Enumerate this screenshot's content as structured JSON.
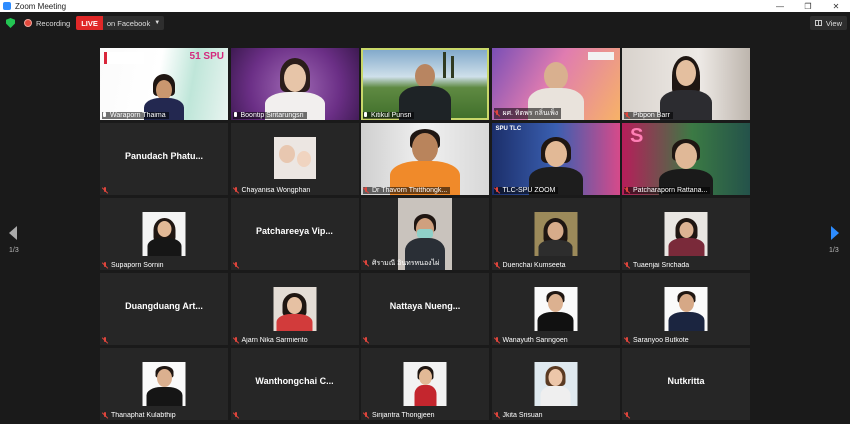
{
  "window": {
    "title": "Zoom Meeting"
  },
  "toolbar": {
    "recording": "Recording",
    "live_badge": "LIVE",
    "live_destination": "on Facebook",
    "view_label": "View"
  },
  "pager": {
    "left_label": "1/3",
    "right_label": "1/3"
  },
  "colors": {
    "accent": "#2d8cff",
    "live_red": "#e02828",
    "mute_red": "#e0453c",
    "active_speaker": "#c9d86a"
  },
  "participants": [
    {
      "name": "Waraporn Thaima",
      "mic": "on"
    },
    {
      "name": "Boontip Siritarungsri",
      "mic": "on"
    },
    {
      "name": "Kitikul Punsri",
      "mic": "on",
      "active": true
    },
    {
      "name": "ผศ. ทิตพร กลิ่นเพ็ง",
      "mic": "off"
    },
    {
      "name": "Pibpon Barr",
      "mic": "off"
    },
    {
      "name": "Panudach Phatu...",
      "mic": "off"
    },
    {
      "name": "Chayanisa Wongphan",
      "mic": "off"
    },
    {
      "name": "Dr Thavorn Thitthongk...",
      "mic": "off"
    },
    {
      "name": "TLC-SPU ZOOM",
      "mic": "off"
    },
    {
      "name": "Patcharaporn Rattana...",
      "mic": "off"
    },
    {
      "name": "Supaporn Sornin",
      "mic": "off"
    },
    {
      "name": "Patchareeya Vip...",
      "mic": "off"
    },
    {
      "name": "ศิรามณี อินทรหนองไผ่",
      "mic": "off"
    },
    {
      "name": "Duenchai Kumseeta",
      "mic": "off"
    },
    {
      "name": "Tuaenjai Srichada",
      "mic": "off"
    },
    {
      "name": "Duangduang Art...",
      "mic": "off"
    },
    {
      "name": "Ajarn Nika Sarmiento",
      "mic": "off"
    },
    {
      "name": "Nattaya Nueng...",
      "mic": "off"
    },
    {
      "name": "Wanayuth Sanngoen",
      "mic": "off"
    },
    {
      "name": "Saranyoo Butkote",
      "mic": "off"
    },
    {
      "name": "Thanaphat Kulabthip",
      "mic": "off"
    },
    {
      "name": "Wanthongchai C...",
      "mic": "off"
    },
    {
      "name": "Sirijantra Thongjeen",
      "mic": "off"
    },
    {
      "name": "Jkita Srisuan",
      "mic": "off"
    },
    {
      "name": "Nutkritta",
      "mic": "off"
    }
  ],
  "logos": {
    "spu": "51 SPU",
    "spu_tlc": "SPU TLC"
  }
}
